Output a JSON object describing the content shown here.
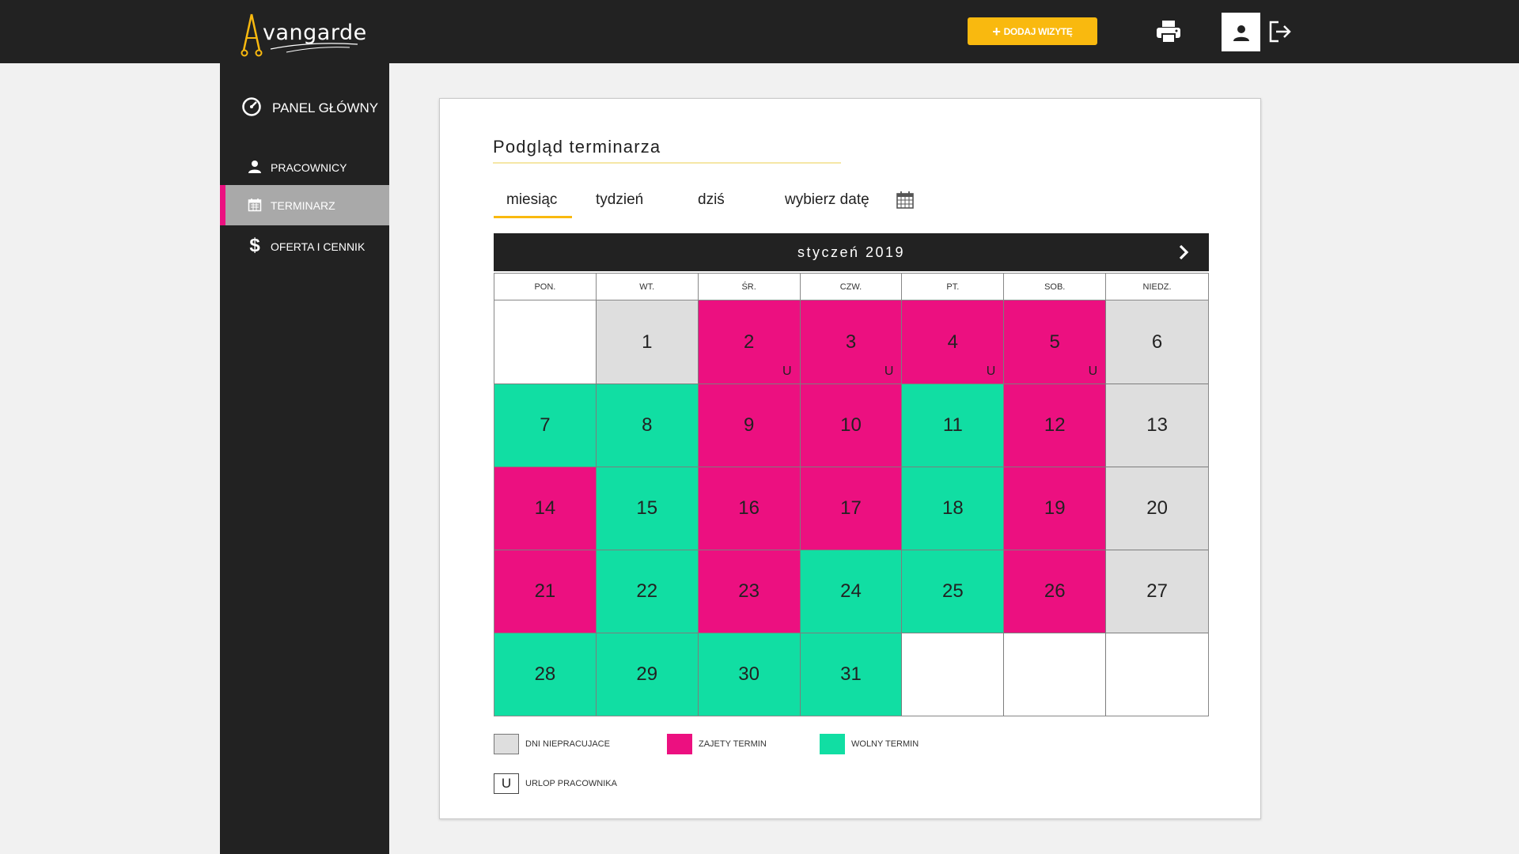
{
  "brand": {
    "name": "vangarde",
    "accent": "#f9b90f"
  },
  "topbar": {
    "add_visit_label": "DODAJ WIZYTĘ",
    "print_icon": "printer-icon",
    "user_icon": "user-icon",
    "logout_icon": "logout-icon"
  },
  "sidebar": {
    "header": {
      "label": "PANEL GŁÓWNY",
      "icon": "dashboard-gauge-icon"
    },
    "items": [
      {
        "label": "PRACOWNICY",
        "icon": "person-icon",
        "active": false
      },
      {
        "label": "TERMINARZ",
        "icon": "calendar-icon",
        "active": true
      },
      {
        "label": "OFERTA I CENNIK",
        "icon": "dollar-icon",
        "active": false
      }
    ]
  },
  "panel": {
    "title": "Podgląd terminarza",
    "tabs": [
      {
        "label": "miesiąc",
        "active": true
      },
      {
        "label": "tydzień",
        "active": false
      },
      {
        "label": "dziś",
        "active": false
      },
      {
        "label": "wybierz datę",
        "active": false
      }
    ]
  },
  "calendar": {
    "month_label": "styczeń 2019",
    "weekdays": [
      "PON.",
      "WT.",
      "ŚR.",
      "CZW.",
      "PT.",
      "SOB.",
      "NIEDZ."
    ],
    "colors": {
      "booked": "#ec1080",
      "free": "#11dea3",
      "off": "#dedede",
      "empty": "#ffffff"
    },
    "cells": [
      {
        "day": "",
        "status": "empty"
      },
      {
        "day": "1",
        "status": "off"
      },
      {
        "day": "2",
        "status": "booked",
        "leave": "U"
      },
      {
        "day": "3",
        "status": "booked",
        "leave": "U"
      },
      {
        "day": "4",
        "status": "booked",
        "leave": "U"
      },
      {
        "day": "5",
        "status": "booked",
        "leave": "U"
      },
      {
        "day": "6",
        "status": "off"
      },
      {
        "day": "7",
        "status": "free"
      },
      {
        "day": "8",
        "status": "free"
      },
      {
        "day": "9",
        "status": "booked"
      },
      {
        "day": "10",
        "status": "booked"
      },
      {
        "day": "11",
        "status": "free"
      },
      {
        "day": "12",
        "status": "booked"
      },
      {
        "day": "13",
        "status": "off"
      },
      {
        "day": "14",
        "status": "booked"
      },
      {
        "day": "15",
        "status": "free"
      },
      {
        "day": "16",
        "status": "booked"
      },
      {
        "day": "17",
        "status": "booked"
      },
      {
        "day": "18",
        "status": "free"
      },
      {
        "day": "19",
        "status": "booked"
      },
      {
        "day": "20",
        "status": "off"
      },
      {
        "day": "21",
        "status": "booked"
      },
      {
        "day": "22",
        "status": "free"
      },
      {
        "day": "23",
        "status": "booked"
      },
      {
        "day": "24",
        "status": "free"
      },
      {
        "day": "25",
        "status": "free"
      },
      {
        "day": "26",
        "status": "booked"
      },
      {
        "day": "27",
        "status": "off"
      },
      {
        "day": "28",
        "status": "free"
      },
      {
        "day": "29",
        "status": "free"
      },
      {
        "day": "30",
        "status": "free"
      },
      {
        "day": "31",
        "status": "free"
      },
      {
        "day": "",
        "status": "empty"
      },
      {
        "day": "",
        "status": "empty"
      },
      {
        "day": "",
        "status": "empty"
      }
    ]
  },
  "legend": {
    "off": "DNI NIEPRACUJACE",
    "booked": "ZAJETY TERMIN",
    "free": "WOLNY TERMIN",
    "leave_symbol": "U",
    "leave": "URLOP PRACOWNIKA"
  }
}
